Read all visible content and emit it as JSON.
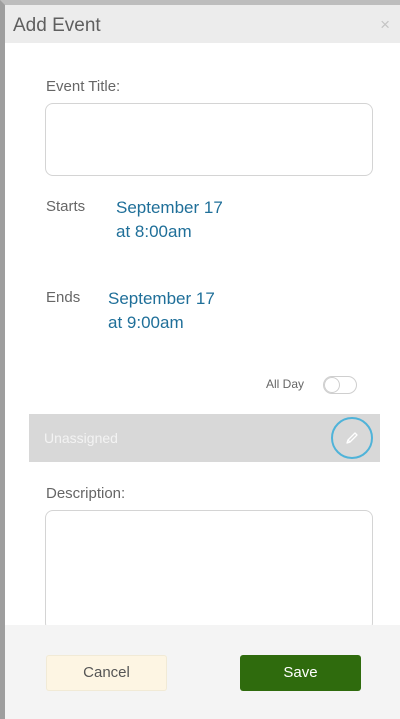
{
  "dialog": {
    "title": "Add Event",
    "close_symbol": "×"
  },
  "event_title": {
    "label": "Event Title:",
    "value": ""
  },
  "starts": {
    "label": "Starts",
    "date": "September 17",
    "time": "at 8:00am"
  },
  "ends": {
    "label": "Ends",
    "date": "September 17",
    "time": "at 9:00am"
  },
  "all_day": {
    "label": "All Day",
    "enabled": false
  },
  "assignee": {
    "value": "Unassigned",
    "edit_icon": "pencil-icon",
    "accent_color": "#4fb3d9"
  },
  "description": {
    "label": "Description:",
    "value": ""
  },
  "actions": {
    "cancel_label": "Cancel",
    "save_label": "Save",
    "save_color": "#2f6b0d"
  },
  "colors": {
    "date_text": "#1f6f99"
  }
}
